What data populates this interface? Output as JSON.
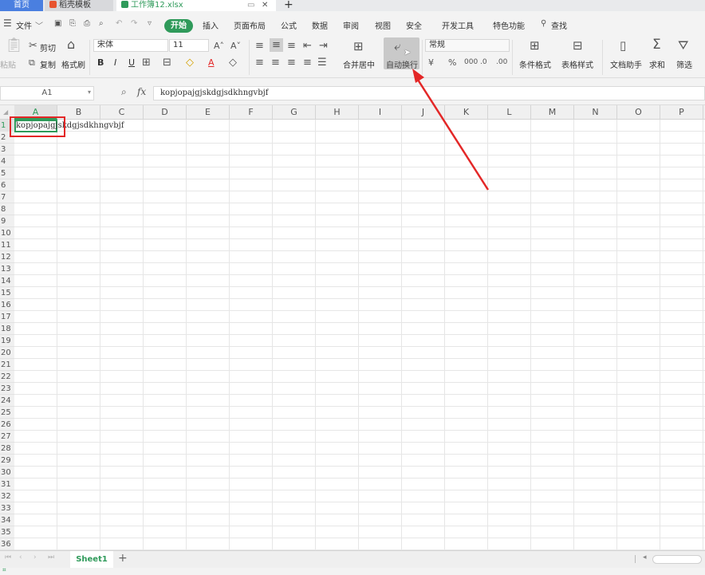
{
  "tabs": {
    "home": "首页",
    "templates": "稻壳模板",
    "file": "工作簿12.xlsx",
    "add": "+"
  },
  "menu": {
    "file": "文件",
    "start": "开始",
    "insert": "插入",
    "page_layout": "页面布局",
    "formulas": "公式",
    "data": "数据",
    "review": "审阅",
    "view": "视图",
    "security": "安全",
    "developer": "开发工具",
    "features": "特色功能",
    "search": "查找"
  },
  "ribbon": {
    "paste": "粘贴",
    "cut": "剪切",
    "copy": "复制",
    "format_painter": "格式刷",
    "font_name": "宋体",
    "font_size": "11",
    "bold": "B",
    "italic": "I",
    "underline": "U",
    "font_color_glyph": "A",
    "merge_center": "合并居中",
    "wrap_text": "自动换行",
    "number_format": "常规",
    "conditional_format": "条件格式",
    "table_style": "表格样式",
    "doc_assistant": "文档助手",
    "sum": "求和",
    "filter": "筛选"
  },
  "formula_bar": {
    "name_box": "A1",
    "fx": "fx",
    "content": "kopjopajgjskdgjsdkhngvbjf"
  },
  "grid": {
    "columns": [
      "A",
      "B",
      "C",
      "D",
      "E",
      "F",
      "G",
      "H",
      "I",
      "J",
      "K",
      "L",
      "M",
      "N",
      "O",
      "P"
    ],
    "rows": [
      "1",
      "2",
      "3",
      "4",
      "5",
      "6",
      "7",
      "8",
      "9",
      "10",
      "11",
      "12",
      "13",
      "14",
      "15",
      "16",
      "17",
      "18",
      "19",
      "20",
      "21",
      "22",
      "23",
      "24",
      "25",
      "26",
      "27",
      "28",
      "29",
      "30",
      "31",
      "32",
      "33",
      "34",
      "35",
      "36"
    ],
    "cell_a1": "kopjopajgjskdgjsdkhngvbjf"
  },
  "sheets": {
    "active": "Sheet1",
    "add": "+"
  },
  "colors": {
    "accent_green": "#2f9a5a",
    "annotation_red": "#e32727",
    "tab_blue": "#4a7fe0"
  }
}
